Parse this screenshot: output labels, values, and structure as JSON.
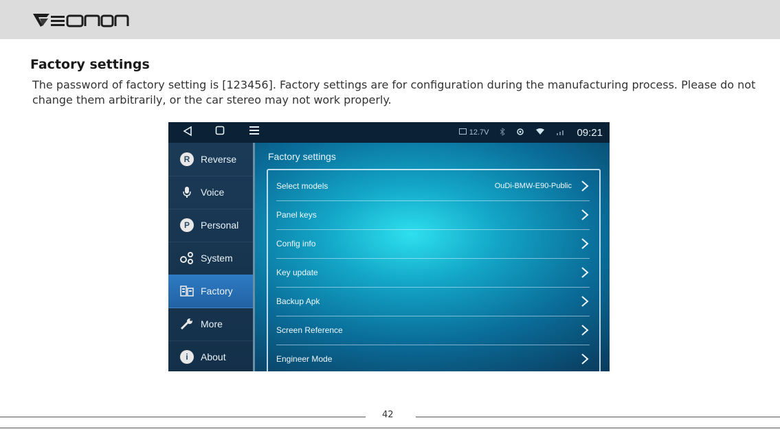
{
  "header": {
    "brand_logo_text": "Eonon"
  },
  "section": {
    "title": "Factory settings",
    "description": "The password of factory setting is [123456]. Factory settings are for configuration during the manufacturing process. Please do not change them arbitrarily, or the car stereo may not work properly."
  },
  "device": {
    "statusbar": {
      "nav_icons": [
        "back-icon",
        "home-icon",
        "menu-icon"
      ],
      "voltage": "12.7V",
      "time": "09:21"
    },
    "sidebar": {
      "items": [
        {
          "label": "Reverse",
          "icon": "reverse-icon",
          "active": false
        },
        {
          "label": "Voice",
          "icon": "microphone-icon",
          "active": false
        },
        {
          "label": "Personal",
          "icon": "personal-icon",
          "active": false
        },
        {
          "label": "System",
          "icon": "system-gears-icon",
          "active": false
        },
        {
          "label": "Factory",
          "icon": "factory-icon",
          "active": true
        },
        {
          "label": "More",
          "icon": "wrench-icon",
          "active": false
        },
        {
          "label": "About",
          "icon": "info-icon",
          "active": false
        }
      ]
    },
    "panel": {
      "title": "Factory settings",
      "rows": [
        {
          "label": "Select models",
          "value": "OuDi-BMW-E90-Public"
        },
        {
          "label": "Panel keys",
          "value": ""
        },
        {
          "label": "Config info",
          "value": ""
        },
        {
          "label": "Key update",
          "value": ""
        },
        {
          "label": "Backup Apk",
          "value": ""
        },
        {
          "label": "Screen Reference",
          "value": ""
        },
        {
          "label": "Engineer Mode",
          "value": ""
        }
      ]
    }
  },
  "footer": {
    "page_number": "42"
  },
  "colors": {
    "active_item": "#2a6fb4",
    "sidebar_bg": "#173650",
    "screen_accent": "#1fc3dc"
  }
}
